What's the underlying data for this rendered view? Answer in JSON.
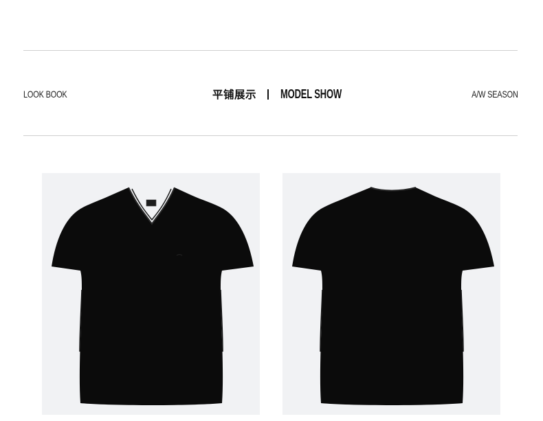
{
  "header": {
    "left_label": "LOOK BOOK",
    "center_title_cn": "平铺展示",
    "center_title_en": "MODEL SHOW",
    "right_label": "A/W SEASON"
  },
  "colors": {
    "rule": "#cfcfcf",
    "photo_background": "#f1f2f4",
    "garment": "#0b0b0b"
  },
  "photos": [
    {
      "view": "front",
      "garment": "black v-neck t-shirt"
    },
    {
      "view": "back",
      "garment": "black t-shirt"
    }
  ]
}
